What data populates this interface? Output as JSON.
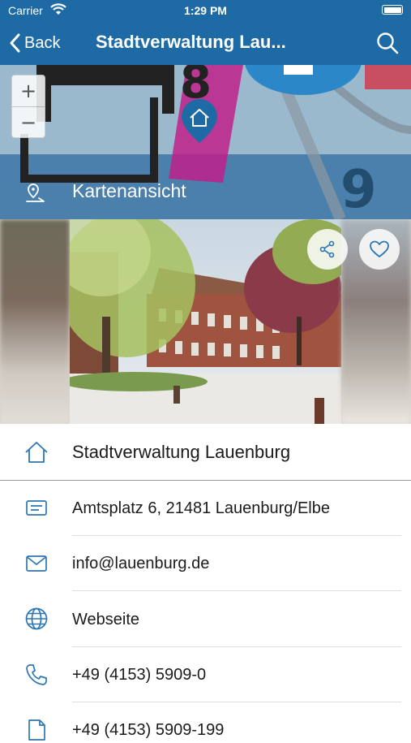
{
  "status_bar": {
    "carrier": "Carrier",
    "time": "1:29 PM"
  },
  "nav": {
    "back_label": "Back",
    "title": "Stadtverwaltung Lau...",
    "back_icon": "chevron-left-icon",
    "search_icon": "search-icon"
  },
  "map": {
    "zoom_in": "+",
    "zoom_out": "−",
    "label": "Kartenansicht",
    "marker_icon": "home-marker-icon",
    "label_icon": "map-pin-icon"
  },
  "carousel": {
    "share_icon": "share-icon",
    "favorite_icon": "heart-icon"
  },
  "details": {
    "name": "Stadtverwaltung Lauenburg",
    "address": "Amtsplatz 6, 21481 Lauenburg/Elbe",
    "email": "info@lauenburg.de",
    "website": "Webseite",
    "phone": "+49 (4153) 5909-0",
    "fax": "+49 (4153) 5909-199"
  },
  "colors": {
    "header": "#1e6aa4",
    "icon": "#2c77b3"
  }
}
